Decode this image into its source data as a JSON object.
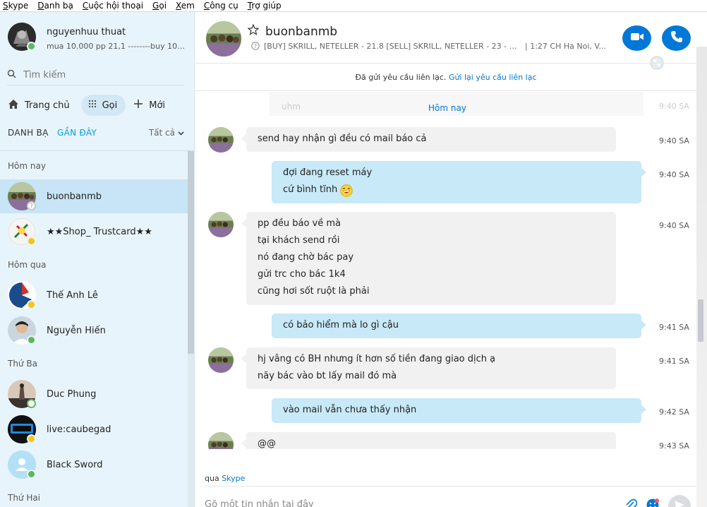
{
  "menu": [
    "Skype",
    "Danh bạ",
    "Cuộc hội thoại",
    "Gọi",
    "Xem",
    "Công cụ",
    "Trợ giúp"
  ],
  "profile": {
    "name": "nguyenhuu thuat",
    "mood": "mua 10.000 pp 21,1 --------buy 10k p..."
  },
  "search": {
    "placeholder": "Tìm kiếm"
  },
  "nav": {
    "home": "Trang chủ",
    "call": "Gọi",
    "new": "Mới"
  },
  "tabs": {
    "contacts": "DANH BẠ",
    "recent": "GẦN ĐÂY",
    "filter": "Tất cả"
  },
  "groups": {
    "today": "Hôm nay",
    "yesterday": "Hôm qua",
    "tuesday": "Thứ Ba",
    "monday": "Thứ Hai"
  },
  "contacts": [
    {
      "name": "buonbanmb",
      "status": "unknown"
    },
    {
      "name": "★★Shop_ Trustcard★★",
      "status": "away"
    },
    {
      "name": "Thế Anh Lê",
      "status": "away"
    },
    {
      "name": "Nguyễn Hiến",
      "status": "online"
    },
    {
      "name": "Duc Phung",
      "status": "offline"
    },
    {
      "name": "live:caubegad",
      "status": "away"
    },
    {
      "name": "Black Sword",
      "status": "online"
    }
  ],
  "chat": {
    "title": "buonbanmb",
    "mood": "[BUY] SKRILL, NETELLER - 21.8 [SELL] SKRILL, NETELLER - 23 - ALL...",
    "location": "| 1:27 CH Ha Noi, V...",
    "notice_text": "Đã gửi yêu cầu liên lạc.",
    "notice_link": "Gửi lại yêu cầu liên lạc",
    "ghost_text": "uhm",
    "ghost_time": "9:40 SA",
    "day_label": "Hôm nay",
    "messages": [
      {
        "dir": "in",
        "lines": [
          "send hay nhận gì đều có mail báo cả"
        ],
        "time": "9:40 SA"
      },
      {
        "dir": "out",
        "lines": [
          "đợi đang reset máy",
          "cứ bình tĩnh"
        ],
        "time": "9:40 SA"
      },
      {
        "dir": "in",
        "lines": [
          "pp đều báo về mà",
          "tại khách send rồi",
          "nó đang chờ bác pay",
          "gửi trc cho bác 1k4",
          "cũng hơi sốt ruột là phải"
        ],
        "time": "9:40 SA"
      },
      {
        "dir": "out",
        "lines": [
          "có bảo hiểm mà lo gì cậu"
        ],
        "time": "9:41 SA"
      },
      {
        "dir": "in",
        "lines": [
          "hj vâng có BH nhưng ít hơn số tiền đang giao dịch ạ",
          "nãy bác vào bt lấy mail đó mà"
        ],
        "time": "9:41 SA"
      },
      {
        "dir": "out",
        "lines": [
          "vào mail vẫn chưa thấy nhận"
        ],
        "time": "9:42 SA"
      },
      {
        "dir": "in",
        "lines": [
          "@@"
        ],
        "time": "9:43 SA"
      }
    ],
    "via_prefix": "qua",
    "via_link": "Skype",
    "compose_placeholder": "Gõ một tin nhắn tại đây"
  },
  "colors": {
    "accent": "#0078d7",
    "link": "#00a1e4",
    "sidebar_bg": "#e8f4fb",
    "selected": "#c7e5f6",
    "out_bubble": "#c7e9f8",
    "in_bubble": "#f1f1f1"
  }
}
